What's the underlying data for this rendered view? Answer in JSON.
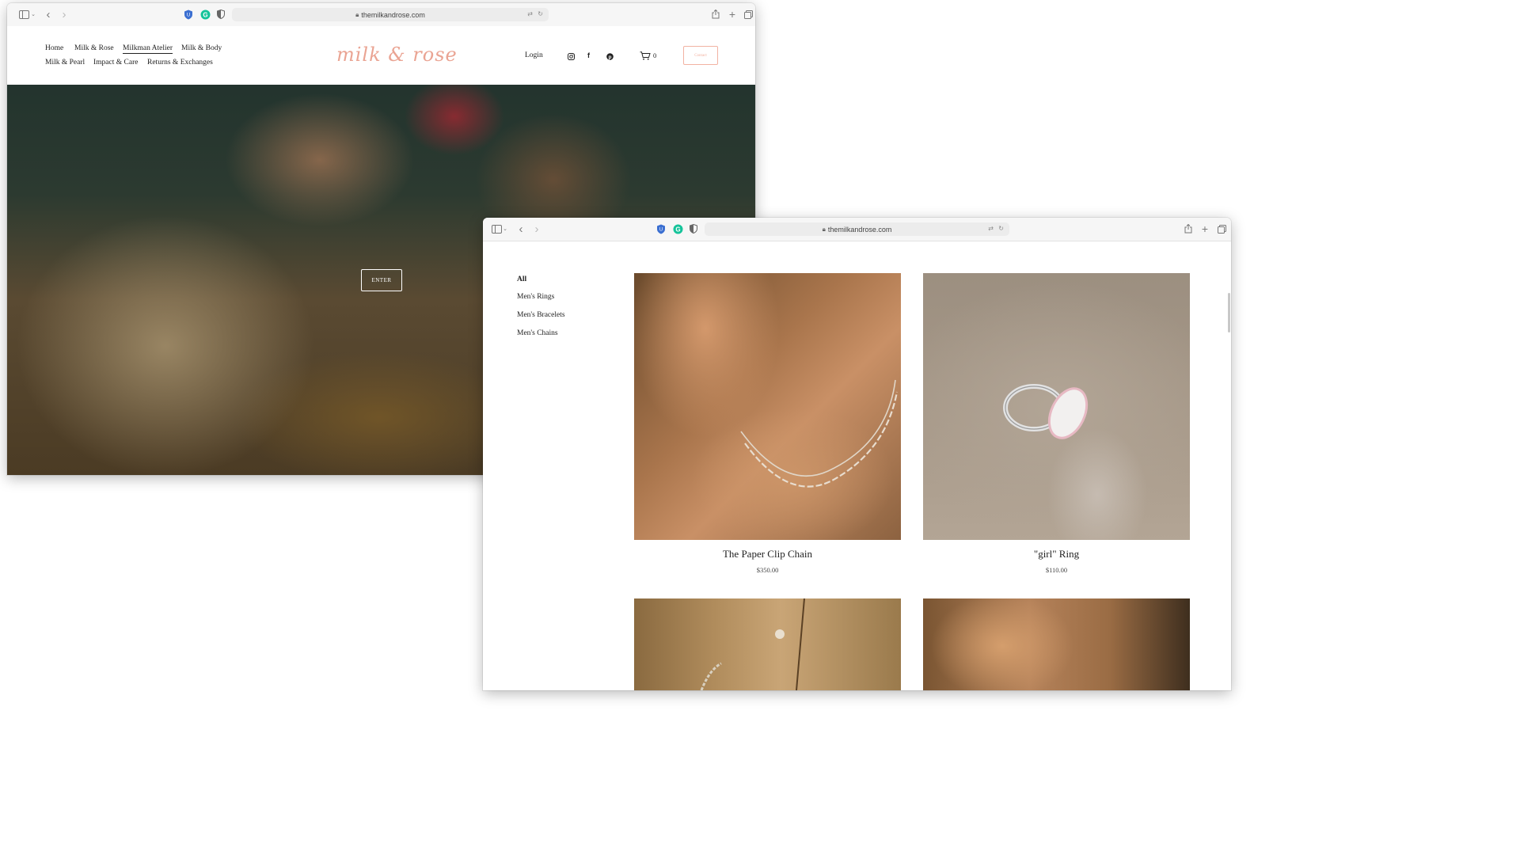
{
  "window1": {
    "url": "themilkandrose.com",
    "nav": {
      "row1": [
        "Home",
        "Milk & Rose",
        "Milkman Atelier",
        "Milk & Body"
      ],
      "row2": [
        "Milk & Pearl",
        "Impact & Care",
        "Returns & Exchanges"
      ]
    },
    "logo": "milk & rose",
    "login": "Login",
    "cart_count": "0",
    "contact_label": "Contact",
    "hero_button": "ENTER"
  },
  "window2": {
    "url": "themilkandrose.com",
    "filters": [
      "All",
      "Men's Rings",
      "Men's Bracelets",
      "Men's Chains"
    ],
    "products": [
      {
        "title": "The Paper Clip Chain",
        "price": "$350.00"
      },
      {
        "title": "\"girl\" Ring",
        "price": "$110.00"
      }
    ]
  },
  "colors": {
    "accent": "#f2b2a2",
    "logo": "#eaa493"
  }
}
